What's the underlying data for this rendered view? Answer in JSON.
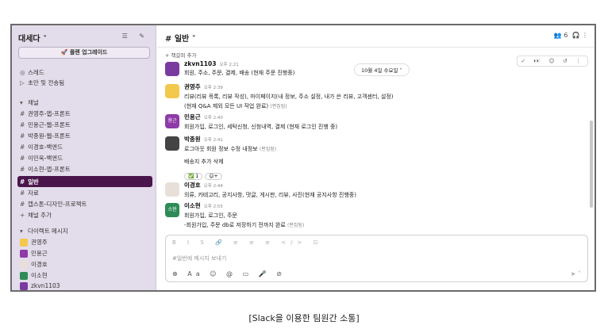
{
  "sidebar": {
    "workspace": "대세다",
    "upgrade_label": "플랜 업그레이드",
    "top_items": [
      {
        "icon": "thread-icon",
        "label": "스레드"
      },
      {
        "icon": "send-icon",
        "label": "초안 및 전송됨"
      }
    ],
    "channels_header": "채널",
    "channels": [
      "권영주-앱-프론트",
      "민용근-웹-프론트",
      "박종원-웹-프론트",
      "이경호-백엔드",
      "이민욱-백엔드",
      "이소현-앱-프론트",
      "일반",
      "자료",
      "캡스톤-디자인-프로젝트"
    ],
    "add_channel": "채널 추가",
    "dm_header": "다이렉트 메시지",
    "dms": [
      "권영주",
      "민용근",
      "이경호",
      "이소현",
      "zkvn1103"
    ]
  },
  "header": {
    "channel": "# 일반",
    "member_count": "6",
    "bookmark": "+ 책갈피 추가"
  },
  "date_divider": "10월 4일 수요일",
  "messages": [
    {
      "name": "zkvn1103",
      "time": "오후 2:21",
      "lines": [
        "회원, 주소, 주문, 결제, 배송 (현재 주문 진행중)"
      ],
      "color": "#7a3aa0"
    },
    {
      "name": "권영주",
      "time": "오후 2:39",
      "lines": [
        "리뷰(리뷰 목록, 리뷰 작성), 마이페이지(내 정보, 주소 설정, 내가 쓴 리뷰, 고객센터, 설정)",
        "(현재 Q&A 제외 모든 UI 작업 완료)"
      ],
      "edited": "(편집됨)",
      "color": "#f2c94c"
    },
    {
      "name": "민용근",
      "time": "오후 2:40",
      "lines": [
        "회원가입, 로그인, 세탁신청, 신청내역, 결제 (현재 로그인 진행 중)"
      ],
      "color": "#8e3aa8",
      "initial": "용근"
    },
    {
      "name": "박종원",
      "time": "오후 2:41",
      "lines": [
        "로그아웃 회원 정보 수정 내정보"
      ],
      "edited": "(편집됨)",
      "extra": "배송지 추가 삭제",
      "react": "✅ 1",
      "color": "#444"
    },
    {
      "name": "이경호",
      "time": "오후 2:44",
      "lines": [
        "의류, 카테고리, 공지사항, 댓글, 게시판, 리뷰, 사진(현재 공지사항 진행중)"
      ],
      "color": "#e8e0d8"
    },
    {
      "name": "이소현",
      "time": "오후 2:55",
      "lines": [
        "회원가입, 로그인, 주문",
        "-회원가입, 주문 db로 저장하기 전까지 완료"
      ],
      "edited": "(편집됨)",
      "color": "#2e8b57",
      "initial": "소현"
    }
  ],
  "composer": {
    "placeholder": "#일반에 메시지 보내기"
  },
  "caption": "[Slack을 이용한 팀원간 소통]"
}
